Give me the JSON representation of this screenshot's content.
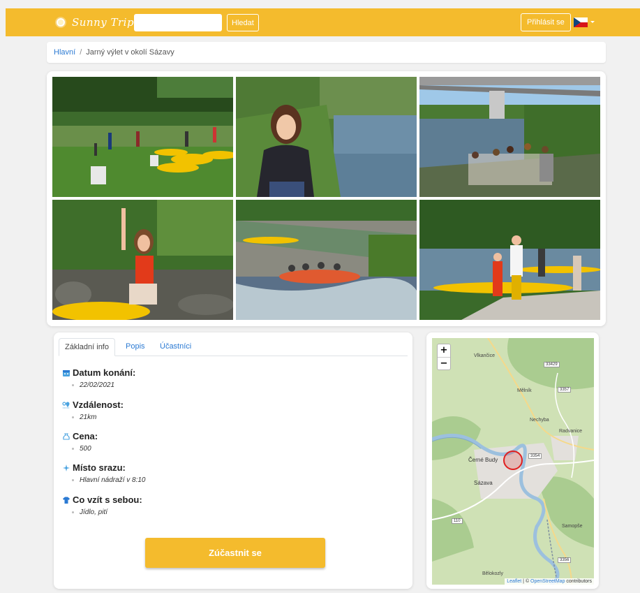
{
  "header": {
    "brand": "Sunny Trips",
    "search_button": "Hledat",
    "search_value": "",
    "login_button": "Přihlásit se"
  },
  "breadcrumb": {
    "home": "Hlavní",
    "separator": "/",
    "current": "Jarný výlet v okolí Sázavy"
  },
  "tabs": [
    "Základní info",
    "Popis",
    "Účastníci"
  ],
  "info": [
    {
      "icon": "calendar-icon",
      "label": "Datum konání:",
      "value": "22/02/2021"
    },
    {
      "icon": "map-pin-icon",
      "label": "Vzdálenost:",
      "value": "21km"
    },
    {
      "icon": "money-bag-icon",
      "label": "Cena:",
      "value": "500"
    },
    {
      "icon": "compass-icon",
      "label": "Místo srazu:",
      "value": "Hlavní nádraží v 8:10"
    },
    {
      "icon": "shirt-icon",
      "label": "Co vzít s sebou:",
      "value": "Jídlo, pití"
    }
  ],
  "join_button": "Zúčastnit se",
  "map": {
    "zoom_in": "+",
    "zoom_out": "−",
    "places": [
      "Vlkančice",
      "Mělník",
      "Nechyba",
      "Radvanice",
      "Černé Budy",
      "Sázava",
      "Samopše",
      "Bělokozly"
    ],
    "roads": [
      "33429",
      "3357",
      "3354",
      "110",
      "3356"
    ],
    "attribution_leaflet": "Leaflet",
    "attribution_sep": " | © ",
    "attribution_osm": "OpenStreetMap",
    "attribution_rest": " contributors"
  },
  "colors": {
    "brand": "#f4bb2d",
    "link": "#2b7ad3",
    "marker": "#e02020"
  }
}
